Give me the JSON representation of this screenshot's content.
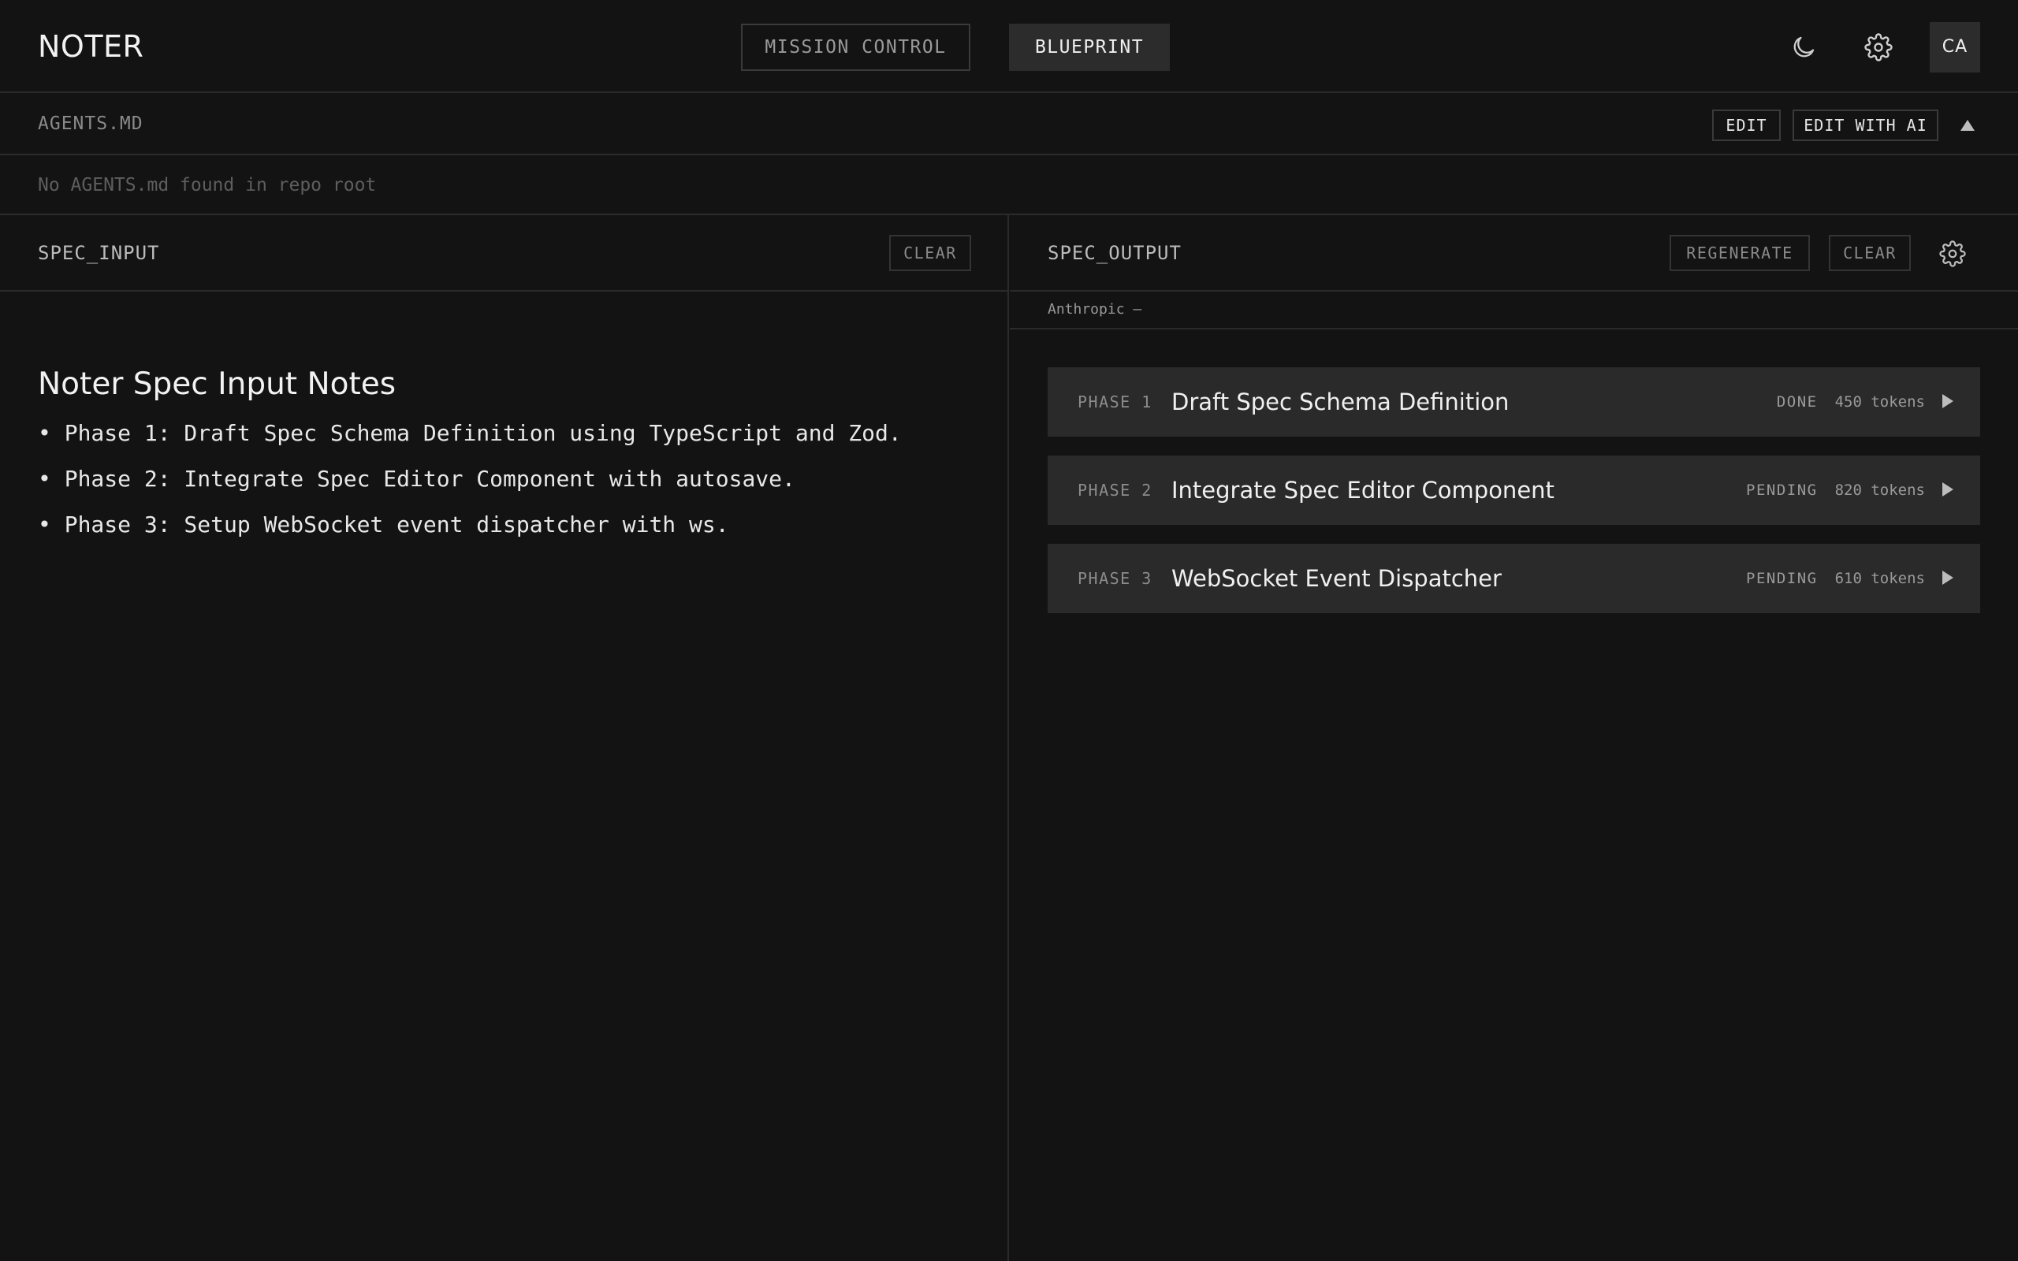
{
  "header": {
    "brand": "NOTER",
    "tabs": [
      {
        "label": "MISSION CONTROL",
        "active": false
      },
      {
        "label": "BLUEPRINT",
        "active": true
      }
    ],
    "avatar_initials": "CA",
    "icons": [
      "moon-icon",
      "gear-icon"
    ]
  },
  "agents": {
    "title": "AGENTS.MD",
    "edit_label": "EDIT",
    "edit_ai_label": "EDIT WITH AI",
    "empty_message": "No AGENTS.md found in repo root"
  },
  "spec_input": {
    "title": "SPEC_INPUT",
    "clear_label": "CLEAR",
    "notes_title": "Noter Spec Input Notes",
    "notes": [
      "• Phase 1: Draft Spec Schema Definition using TypeScript and Zod.",
      "• Phase 2: Integrate Spec Editor Component with autosave.",
      "• Phase 3: Setup WebSocket event dispatcher with ws."
    ]
  },
  "spec_output": {
    "title": "SPEC_OUTPUT",
    "regenerate_label": "REGENERATE",
    "clear_label": "CLEAR",
    "provider": "Anthropic —",
    "phases": [
      {
        "label": "PHASE 1",
        "title": "Draft Spec Schema Definition",
        "status": "DONE",
        "tokens": "450 tokens"
      },
      {
        "label": "PHASE 2",
        "title": "Integrate Spec Editor Component",
        "status": "PENDING",
        "tokens": "820 tokens"
      },
      {
        "label": "PHASE 3",
        "title": "WebSocket Event Dispatcher",
        "status": "PENDING",
        "tokens": "610 tokens"
      }
    ]
  },
  "colors": {
    "background": "#131313",
    "panel_card": "#2a2a2a",
    "border": "#2b2b2b",
    "text_primary": "#f0f0f0",
    "text_muted": "#8a8a8a"
  }
}
